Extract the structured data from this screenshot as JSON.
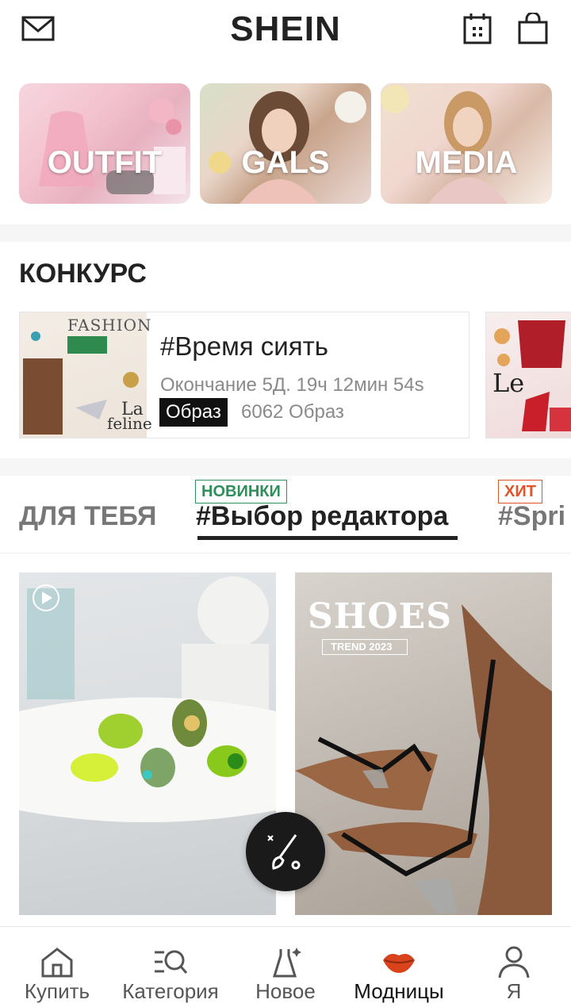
{
  "header": {
    "logo": "SHEIN",
    "icons": [
      "mail-icon",
      "calendar-icon",
      "shopping-bag-icon"
    ]
  },
  "categories": [
    {
      "label": "OUTFIT"
    },
    {
      "label": "GALS"
    },
    {
      "label": "MEDIA"
    }
  ],
  "contest": {
    "title": "КОНКУРС",
    "card": {
      "thumb_text_1": "FASHION",
      "thumb_text_2": "La",
      "thumb_text_3": "feline",
      "title": "#Время сиять",
      "timer": "Окончание 5Д. 19ч 12мин 54s",
      "badge": "Образ",
      "count": "6062 Образ"
    },
    "card2_text": "Le"
  },
  "tabs": {
    "for_you": "ДЛЯ ТЕБЯ",
    "editor": "#Выбор редактора",
    "spring": "#Spri",
    "new_tag": "НОВИНКИ",
    "hit_tag": "ХИТ"
  },
  "feed": {
    "card2_title": "SHOES",
    "card2_subtitle": "TREND 2023"
  },
  "nav": [
    {
      "label": "Купить",
      "icon": "home-icon"
    },
    {
      "label": "Категория",
      "icon": "category-search-icon"
    },
    {
      "label": "Новое",
      "icon": "dress-sparkle-icon"
    },
    {
      "label": "Модницы",
      "icon": "lips-icon",
      "active": true
    },
    {
      "label": "Я",
      "icon": "profile-icon"
    }
  ],
  "colors": {
    "accent_green": "#2f8f5a",
    "accent_red": "#e2532a",
    "lips": "#d9431b"
  }
}
